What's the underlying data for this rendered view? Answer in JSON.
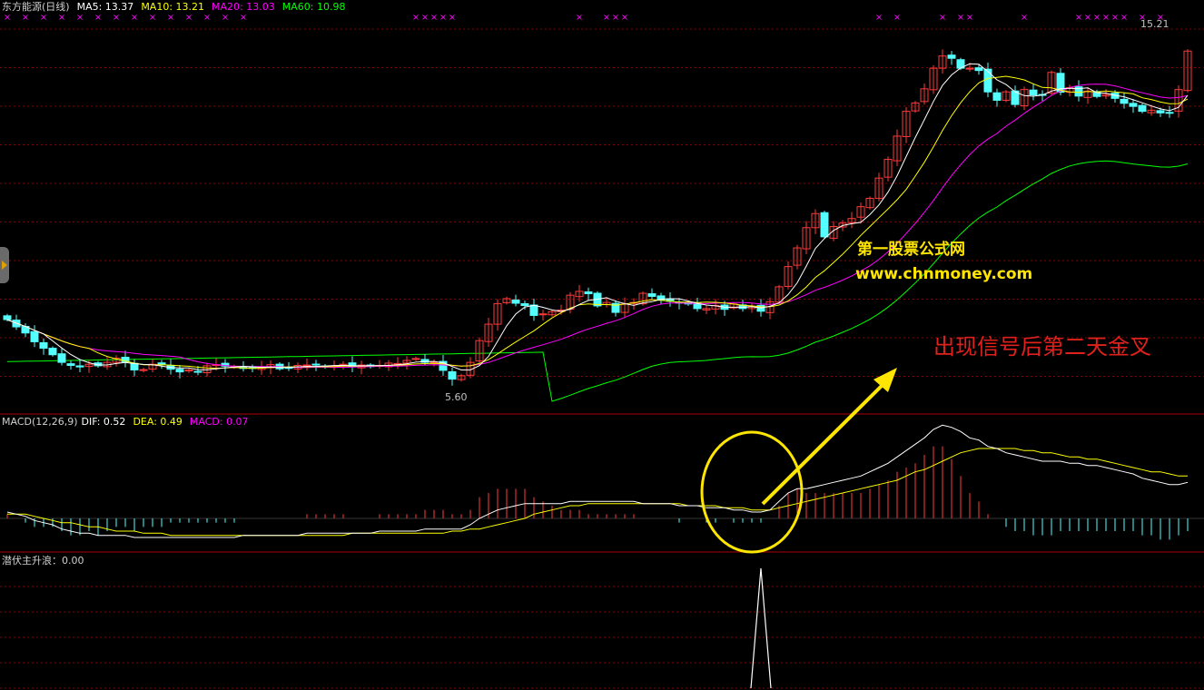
{
  "header": {
    "stock": "东方能源(日线)",
    "ma5": "MA5: 13.37",
    "ma10": "MA10: 13.21",
    "ma20": "MA20: 13.03",
    "ma60": "MA60: 10.98"
  },
  "macd_header": {
    "name": "MACD(12,26,9)",
    "dif": "DIF: 0.52",
    "dea": "DEA: 0.49",
    "macd": "MACD: 0.07"
  },
  "indicator_header": {
    "name": "潜伏主升浪：0.00"
  },
  "labels": {
    "high": "15.21",
    "low": "5.60"
  },
  "annotations": {
    "brand": "第一股票公式网",
    "url": "www.chnmoney.com",
    "signal": "出现信号后第二天金叉"
  },
  "colors": {
    "background": "#000000",
    "up_candle": "#ff3a3a",
    "down_candle": "#54ffff",
    "ma5": "#ffffff",
    "ma10": "#ffff00",
    "ma20": "#ff00ff",
    "ma60": "#00ff00",
    "grid": "#8b0000",
    "annotation_yellow": "#ffe600",
    "annotation_red": "#e0201c"
  },
  "chart_data": {
    "type": "line",
    "price_range": [
      5.2,
      15.6
    ],
    "high": 15.21,
    "low": 5.6,
    "closes": [
      7.65,
      7.46,
      7.3,
      7.07,
      6.9,
      6.73,
      6.53,
      6.45,
      6.41,
      6.48,
      6.44,
      6.53,
      6.64,
      6.54,
      6.33,
      6.34,
      6.48,
      6.47,
      6.35,
      6.28,
      6.33,
      6.27,
      6.44,
      6.47,
      6.43,
      6.42,
      6.37,
      6.38,
      6.4,
      6.47,
      6.36,
      6.38,
      6.45,
      6.46,
      6.47,
      6.41,
      6.44,
      6.48,
      6.41,
      6.46,
      6.42,
      6.45,
      6.51,
      6.5,
      6.58,
      6.63,
      6.53,
      6.53,
      6.32,
      6.09,
      6.18,
      6.53,
      7.1,
      7.53,
      8.07,
      8.2,
      8.08,
      8.02,
      7.76,
      7.8,
      7.86,
      7.9,
      8.29,
      8.39,
      8.33,
      8.01,
      8.1,
      7.84,
      8.06,
      8.1,
      8.34,
      8.26,
      8.16,
      8.13,
      8.09,
      8.06,
      7.94,
      7.94,
      8.02,
      7.92,
      8.06,
      7.94,
      8.0,
      7.87,
      8.12,
      8.51,
      9.04,
      9.53,
      10.06,
      10.43,
      9.82,
      10.09,
      10.18,
      10.3,
      10.61,
      10.83,
      11.36,
      11.85,
      12.46,
      13.11,
      13.33,
      13.7,
      14.24,
      14.56,
      14.5,
      14.24,
      14.24,
      14.18,
      13.62,
      13.4,
      13.62,
      13.29,
      13.68,
      13.54,
      13.55,
      14.13,
      13.61,
      13.73,
      13.51,
      13.64,
      13.5,
      13.55,
      13.45,
      13.32,
      13.24,
      13.11,
      13.14,
      13.07,
      13.08,
      13.68,
      14.69
    ],
    "macd_dif": [
      0.03,
      0.02,
      0.01,
      -0.01,
      -0.02,
      -0.03,
      -0.05,
      -0.06,
      -0.07,
      -0.07,
      -0.08,
      -0.08,
      -0.08,
      -0.08,
      -0.09,
      -0.09,
      -0.09,
      -0.09,
      -0.09,
      -0.09,
      -0.09,
      -0.09,
      -0.09,
      -0.09,
      -0.09,
      -0.09,
      -0.08,
      -0.08,
      -0.08,
      -0.08,
      -0.08,
      -0.08,
      -0.08,
      -0.07,
      -0.07,
      -0.07,
      -0.07,
      -0.07,
      -0.07,
      -0.07,
      -0.07,
      -0.06,
      -0.06,
      -0.06,
      -0.06,
      -0.06,
      -0.05,
      -0.05,
      -0.05,
      -0.05,
      -0.05,
      -0.03,
      -0.0,
      0.02,
      0.04,
      0.05,
      0.06,
      0.07,
      0.07,
      0.07,
      0.07,
      0.07,
      0.08,
      0.08,
      0.08,
      0.08,
      0.08,
      0.08,
      0.08,
      0.08,
      0.07,
      0.07,
      0.07,
      0.07,
      0.06,
      0.06,
      0.06,
      0.05,
      0.05,
      0.05,
      0.04,
      0.04,
      0.03,
      0.03,
      0.04,
      0.08,
      0.12,
      0.14,
      0.14,
      0.15,
      0.16,
      0.17,
      0.18,
      0.19,
      0.2,
      0.22,
      0.24,
      0.26,
      0.29,
      0.32,
      0.35,
      0.38,
      0.42,
      0.44,
      0.43,
      0.41,
      0.38,
      0.37,
      0.34,
      0.33,
      0.31,
      0.3,
      0.29,
      0.28,
      0.27,
      0.27,
      0.27,
      0.26,
      0.26,
      0.25,
      0.25,
      0.24,
      0.23,
      0.22,
      0.21,
      0.19,
      0.18,
      0.17,
      0.16,
      0.16,
      0.17
    ],
    "macd_dea": [
      0.02,
      0.02,
      0.02,
      0.01,
      0.0,
      -0.01,
      -0.02,
      -0.02,
      -0.03,
      -0.04,
      -0.04,
      -0.05,
      -0.06,
      -0.06,
      -0.06,
      -0.07,
      -0.07,
      -0.07,
      -0.08,
      -0.08,
      -0.08,
      -0.08,
      -0.08,
      -0.08,
      -0.08,
      -0.08,
      -0.08,
      -0.08,
      -0.08,
      -0.08,
      -0.08,
      -0.08,
      -0.08,
      -0.08,
      -0.08,
      -0.08,
      -0.08,
      -0.08,
      -0.07,
      -0.07,
      -0.07,
      -0.07,
      -0.07,
      -0.07,
      -0.07,
      -0.07,
      -0.07,
      -0.07,
      -0.07,
      -0.06,
      -0.06,
      -0.05,
      -0.05,
      -0.04,
      -0.03,
      -0.02,
      -0.01,
      0.0,
      0.02,
      0.03,
      0.04,
      0.05,
      0.06,
      0.06,
      0.07,
      0.07,
      0.07,
      0.07,
      0.07,
      0.07,
      0.07,
      0.07,
      0.07,
      0.07,
      0.07,
      0.06,
      0.06,
      0.06,
      0.06,
      0.05,
      0.05,
      0.05,
      0.04,
      0.04,
      0.04,
      0.05,
      0.06,
      0.07,
      0.08,
      0.09,
      0.1,
      0.11,
      0.12,
      0.13,
      0.14,
      0.15,
      0.16,
      0.17,
      0.18,
      0.2,
      0.22,
      0.23,
      0.25,
      0.27,
      0.29,
      0.31,
      0.32,
      0.33,
      0.33,
      0.33,
      0.33,
      0.33,
      0.32,
      0.32,
      0.31,
      0.31,
      0.3,
      0.29,
      0.29,
      0.28,
      0.28,
      0.27,
      0.26,
      0.25,
      0.24,
      0.23,
      0.22,
      0.22,
      0.21,
      0.2,
      0.2
    ],
    "signal": {
      "index": 83,
      "value": 1.0
    }
  }
}
